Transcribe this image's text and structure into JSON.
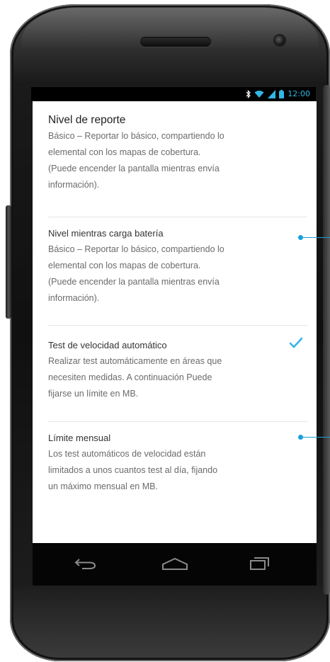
{
  "status_bar": {
    "time": "12:00",
    "icons": [
      "bluetooth-icon",
      "wifi-icon",
      "signal-icon",
      "battery-icon"
    ],
    "accent_color": "#33b5e5"
  },
  "settings": {
    "nivel_reporte": {
      "title": "Nivel de reporte",
      "summary_lines": [
        "Básico – Reportar lo básico, compartiendo lo",
        "elemental con los mapas de cobertura.",
        "(Puede encender la pantalla mientras envía",
        "información)."
      ]
    },
    "nivel_carga": {
      "title": "Nivel mientras carga batería",
      "summary_lines": [
        "Básico – Reportar lo básico, compartiendo lo",
        "elemental con los mapas de cobertura.",
        "(Puede encender la pantalla mientras envía",
        "información)."
      ]
    },
    "test_velocidad": {
      "title": "Test de velocidad automático",
      "checked": true,
      "summary_lines": [
        "Realizar test automáticamente en áreas que",
        "necesiten medidas.  A continuación Puede",
        "fijarse un límite en MB."
      ]
    },
    "limite_mensual": {
      "title": "Límite mensual",
      "summary_lines": [
        "Los test automáticos de velocidad están",
        "limitados a unos cuantos test al día, fijando",
        "un máximo mensual en MB."
      ]
    }
  },
  "nav_bar": {
    "icons": [
      "back-icon",
      "home-icon",
      "recent-apps-icon"
    ]
  },
  "colors": {
    "accent": "#1aa0d8",
    "check": "#33b5e5"
  }
}
